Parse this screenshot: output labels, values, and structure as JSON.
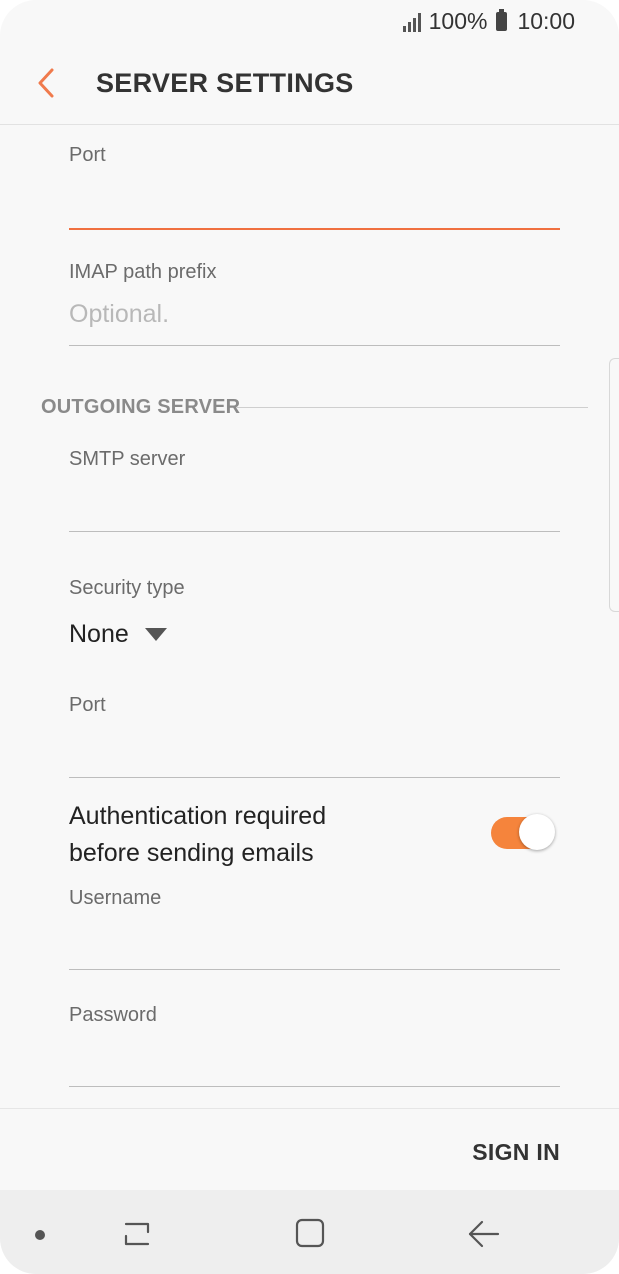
{
  "status": {
    "battery": "100%",
    "time": "10:00"
  },
  "header": {
    "title": "SERVER SETTINGS"
  },
  "incoming": {
    "port_label": "Port",
    "port_value": "",
    "imap_label": "IMAP path prefix",
    "imap_placeholder": "Optional."
  },
  "outgoing": {
    "section_label": "OUTGOING SERVER",
    "smtp_label": "SMTP server",
    "smtp_value": "",
    "security_label": "Security type",
    "security_value": "None",
    "port_label": "Port",
    "port_value": "",
    "auth_line1": "Authentication required",
    "auth_line2": "before sending emails",
    "auth_enabled": true,
    "username_label": "Username",
    "password_label": "Password"
  },
  "actions": {
    "sign_in": "SIGN IN"
  },
  "colors": {
    "accent": "#f07040",
    "toggle": "#f5843c"
  },
  "icons": {
    "back": "back-arrow-icon",
    "recent": "recent-apps-icon",
    "home": "home-icon",
    "nav_back": "nav-back-icon"
  }
}
